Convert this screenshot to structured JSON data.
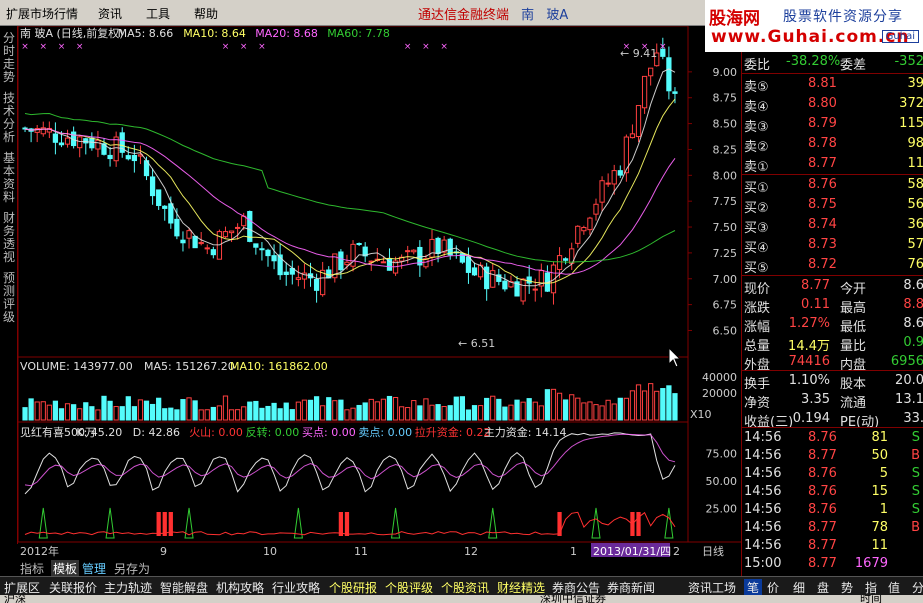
{
  "menu": [
    "扩展市场行情",
    "资讯",
    "工具",
    "帮助"
  ],
  "brand": {
    "text": "通达信金融终端",
    "market": "南",
    "stock": "玻A"
  },
  "logo": {
    "line1": "股海网",
    "line2": "股票软件资源分享",
    "line3": "www.Guhai.com.cn",
    "badge": "Guhai"
  },
  "vtabs": [
    "分时走势",
    "技术分析",
    "基本资料",
    "财务透视",
    "预测评级"
  ],
  "price_panel": {
    "title_parts": [
      {
        "text": "南  玻A (日线,前复权)",
        "color": "#e0e0e0"
      },
      {
        "text": "MA5: 8.66",
        "color": "#e0e0e0"
      },
      {
        "text": "MA10: 8.64",
        "color": "#ffff66"
      },
      {
        "text": "MA20: 8.68",
        "color": "#ff66ff"
      },
      {
        "text": "MA60: 7.78",
        "color": "#33cc33"
      }
    ],
    "high_label": "9.41",
    "low_label": "6.51",
    "axis": [
      "9.00",
      "8.75",
      "8.50",
      "8.25",
      "8.00",
      "7.75",
      "7.50",
      "7.25",
      "7.00",
      "6.75",
      "6.50"
    ]
  },
  "volume_panel": {
    "title": "VOLUME: 143977.00",
    "ma5": "MA5: 151267.20",
    "ma10": "MA10: 161862.00",
    "axis": [
      "40000",
      "20000"
    ],
    "unit": "X10"
  },
  "indicator_panel": {
    "title_parts": [
      {
        "text": "见红有喜500万",
        "color": "#e0e0e0"
      },
      {
        "text": "K: 45.20",
        "color": "#e0e0e0"
      },
      {
        "text": "D: 42.86",
        "color": "#e0e0e0"
      },
      {
        "text": "火山: 0.00",
        "color": "#ff3333"
      },
      {
        "text": "反转: 0.00",
        "color": "#33cc33"
      },
      {
        "text": "买点: 0.00",
        "color": "#ff66ff"
      },
      {
        "text": "卖点: 0.00",
        "color": "#66ccff"
      },
      {
        "text": "拉升资金: 0.22",
        "color": "#ff3333"
      },
      {
        "text": "主力资金: 14.14",
        "color": "#e0e0e0"
      }
    ],
    "axis": [
      "75.00",
      "50.00",
      "25.00"
    ]
  },
  "xaxis": {
    "labels": [
      "2012年",
      "9",
      "10",
      "11",
      "12",
      "1",
      "2"
    ],
    "highlight": "2013/01/31/四",
    "right": "日线"
  },
  "quote": {
    "weibi": "委比",
    "weibi_val": "-38.28%",
    "weicha": "委差",
    "weicha_val": "-352",
    "sells": [
      {
        "label": "卖⑤",
        "price": "8.81",
        "vol": "39"
      },
      {
        "label": "卖④",
        "price": "8.80",
        "vol": "372"
      },
      {
        "label": "卖③",
        "price": "8.79",
        "vol": "115"
      },
      {
        "label": "卖②",
        "price": "8.78",
        "vol": "98"
      },
      {
        "label": "卖①",
        "price": "8.77",
        "vol": "11"
      }
    ],
    "buys": [
      {
        "label": "买①",
        "price": "8.76",
        "vol": "58"
      },
      {
        "label": "买②",
        "price": "8.75",
        "vol": "56"
      },
      {
        "label": "买③",
        "price": "8.74",
        "vol": "36"
      },
      {
        "label": "买④",
        "price": "8.73",
        "vol": "57"
      },
      {
        "label": "买⑤",
        "price": "8.72",
        "vol": "76"
      }
    ],
    "stats": [
      {
        "l": "现价",
        "v": "8.77",
        "vc": "#ff4444",
        "l2": "今开",
        "v2": "8.6",
        "v2c": "#e0e0e0"
      },
      {
        "l": "涨跌",
        "v": "0.11",
        "vc": "#ff4444",
        "l2": "最高",
        "v2": "8.8",
        "v2c": "#ff4444"
      },
      {
        "l": "涨幅",
        "v": "1.27%",
        "vc": "#ff4444",
        "l2": "最低",
        "v2": "8.6",
        "v2c": "#e0e0e0"
      },
      {
        "l": "总量",
        "v": "14.4万",
        "vc": "#ffff66",
        "l2": "量比",
        "v2": "0.9",
        "v2c": "#33cc33"
      },
      {
        "l": "外盘",
        "v": "74416",
        "vc": "#ff4444",
        "l2": "内盘",
        "v2": "6956",
        "v2c": "#33cc33"
      }
    ],
    "stats2": [
      {
        "l": "换手",
        "v": "1.10%",
        "l2": "股本",
        "v2": "20.0"
      },
      {
        "l": "净资",
        "v": "3.35",
        "l2": "流通",
        "v2": "13.1"
      },
      {
        "l": "收益(三)",
        "v": "0.194",
        "l2": "PE(动)",
        "v2": "33."
      }
    ],
    "ticks": [
      {
        "t": "14:56",
        "p": "8.76",
        "pc": "#ff4444",
        "v": "81",
        "vc": "#ffff66",
        "s": "S",
        "sc": "#33cc33"
      },
      {
        "t": "14:56",
        "p": "8.77",
        "pc": "#ff4444",
        "v": "50",
        "vc": "#ffff66",
        "s": "B",
        "sc": "#ff4444"
      },
      {
        "t": "14:56",
        "p": "8.76",
        "pc": "#ff4444",
        "v": "5",
        "vc": "#ffff66",
        "s": "S",
        "sc": "#33cc33"
      },
      {
        "t": "14:56",
        "p": "8.76",
        "pc": "#ff4444",
        "v": "15",
        "vc": "#ffff66",
        "s": "S",
        "sc": "#33cc33"
      },
      {
        "t": "14:56",
        "p": "8.76",
        "pc": "#ff4444",
        "v": "1",
        "vc": "#ffff66",
        "s": "S",
        "sc": "#33cc33"
      },
      {
        "t": "14:56",
        "p": "8.77",
        "pc": "#ff4444",
        "v": "78",
        "vc": "#ffff66",
        "s": "B",
        "sc": "#ff4444"
      },
      {
        "t": "14:56",
        "p": "8.77",
        "pc": "#ff4444",
        "v": "11",
        "vc": "#ffff66",
        "s": "",
        "sc": "#ff4444"
      },
      {
        "t": "15:00",
        "p": "8.77",
        "pc": "#ff4444",
        "v": "1679",
        "vc": "#ff66ff",
        "s": "",
        "sc": "#ff4444"
      }
    ]
  },
  "bottom_tabs": [
    "指标",
    "模板",
    "管理",
    "另存为"
  ],
  "footer": [
    "扩展区",
    "关联报价",
    "主力轨迹",
    "智能解盘",
    "机构攻略",
    "行业攻略",
    "个股研报",
    "个股评级",
    "个股资讯",
    "财经精选",
    "券商公告",
    "券商新闻",
    "资讯工场",
    "笔",
    "价",
    "细",
    "盘",
    "势",
    "指",
    "值",
    "分"
  ],
  "status": [
    "沪深",
    "深圳中信证券",
    "时间"
  ]
}
